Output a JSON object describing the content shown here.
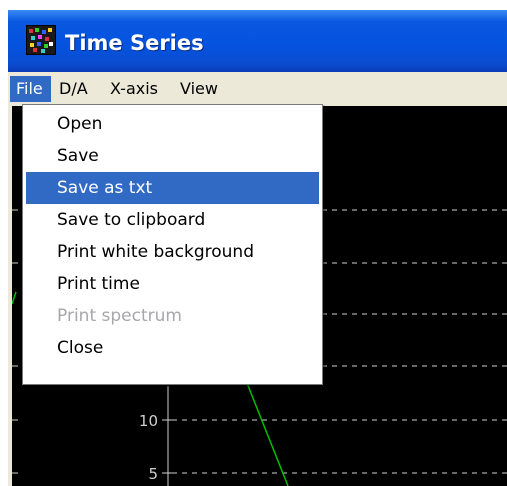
{
  "window": {
    "title": "Time Series",
    "icon": "app-icon"
  },
  "menubar": {
    "items": [
      {
        "label": "File",
        "active": true
      },
      {
        "label": "D/A"
      },
      {
        "label": "X-axis"
      },
      {
        "label": "View"
      }
    ]
  },
  "file_menu": {
    "items": [
      {
        "label": "Open"
      },
      {
        "label": "Save"
      },
      {
        "label": "Save as txt",
        "selected": true
      },
      {
        "label": "Save to clipboard"
      },
      {
        "label": "Print white background"
      },
      {
        "label": "Print time"
      },
      {
        "label": "Print spectrum",
        "disabled": true
      },
      {
        "label": "Close"
      }
    ]
  },
  "plot": {
    "background_color": "#000000",
    "grid_color": "#d0d0d0",
    "trace_color": "#00c000",
    "y_tick_labels": [
      "10",
      "5"
    ]
  },
  "colors": {
    "title_bar": "#0453df",
    "menu_highlight": "#316ac5",
    "disabled_text": "#a7a6aa"
  }
}
